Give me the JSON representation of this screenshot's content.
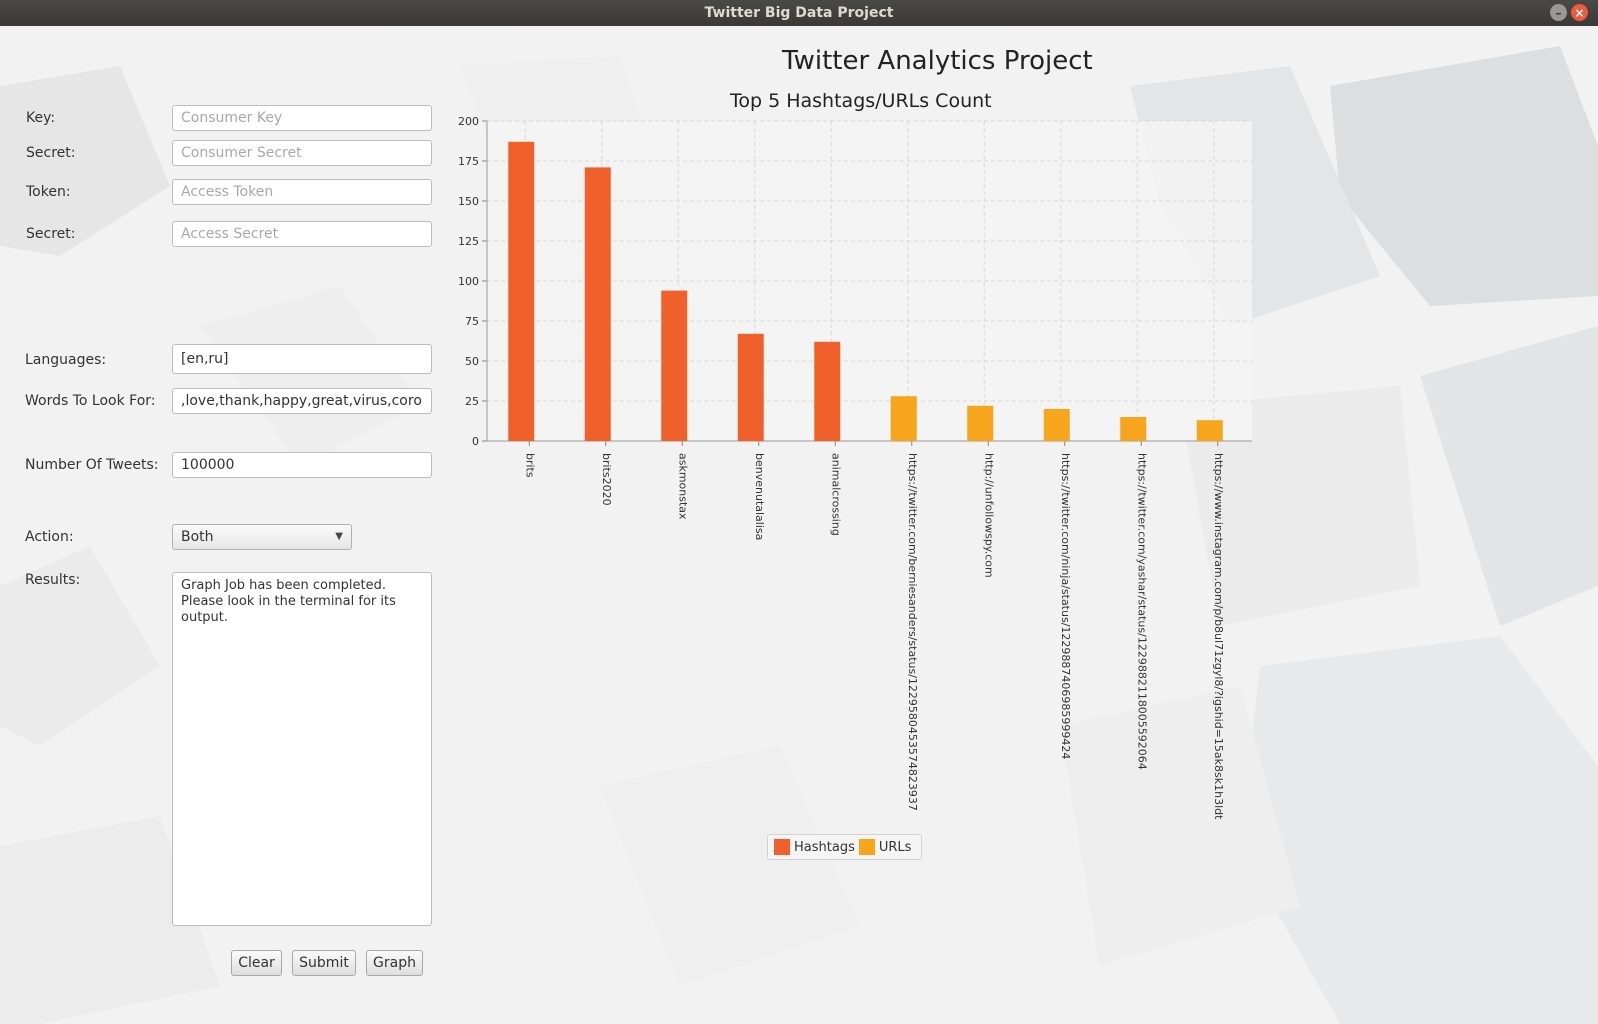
{
  "window": {
    "title": "Twitter Big Data Project"
  },
  "form": {
    "key": {
      "label": "Key:",
      "placeholder": "Consumer Key",
      "value": ""
    },
    "consumer_secret": {
      "label": "Secret:",
      "placeholder": "Consumer Secret",
      "value": ""
    },
    "token": {
      "label": "Token:",
      "placeholder": "Access Token",
      "value": ""
    },
    "access_secret": {
      "label": "Secret:",
      "placeholder": "Access Secret",
      "value": ""
    },
    "languages": {
      "label": "Languages:",
      "value": "[en,ru]"
    },
    "words": {
      "label": "Words To Look For:",
      "value": ",love,thank,happy,great,virus,corona]"
    },
    "tweets": {
      "label": "Number Of Tweets:",
      "value": "100000"
    },
    "action": {
      "label": "Action:",
      "value": "Both"
    },
    "results": {
      "label": "Results:",
      "value": "Graph Job has been completed.\nPlease look in the terminal for its\noutput."
    }
  },
  "buttons": {
    "clear": "Clear",
    "submit": "Submit",
    "graph": "Graph"
  },
  "page_title": "Twitter Analytics Project",
  "colors": {
    "hashtags": "#f0602a",
    "urls": "#f7a51c"
  },
  "chart_data": {
    "type": "bar",
    "title": "Top 5 Hashtags/URLs Count",
    "categories": [
      "brits",
      "brits2020",
      "askmonstax",
      "benvenutalalisa",
      "animalcrossing",
      "https://twitter.com/berniesanders/status/1229580453574823937",
      "http://unfollowspy.com",
      "https://twitter.com/ninja/status/1229887406985999424",
      "https://twitter.com/yashar/status/1229882118005592064",
      "https://www.instagram.com/p/b8ul71zgyl8/?igshid=15ak8sk1h3ldt"
    ],
    "series": [
      {
        "name": "Hashtags",
        "values": [
          187,
          171,
          94,
          67,
          62,
          null,
          null,
          null,
          null,
          null
        ]
      },
      {
        "name": "URLs",
        "values": [
          null,
          null,
          null,
          null,
          null,
          28,
          22,
          20,
          15,
          13
        ]
      }
    ],
    "ylim": [
      0,
      200
    ],
    "yticks": [
      0,
      25,
      50,
      75,
      100,
      125,
      150,
      175,
      200
    ],
    "grid": true,
    "legend": "bottom"
  }
}
